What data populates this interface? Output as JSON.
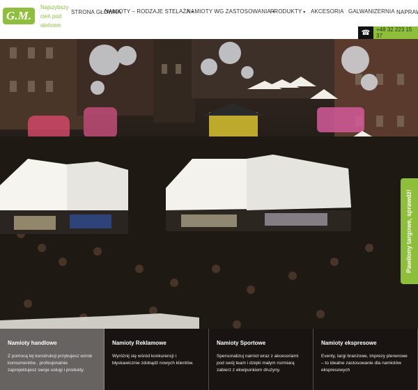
{
  "brand": {
    "logo_text": "G.M.",
    "tagline": "Najszybszy cień pod słońcem",
    "accent_color": "#8dbf3a"
  },
  "nav": {
    "items": [
      {
        "label": "STRONA GŁÓWNA"
      },
      {
        "label": "NAMIOTY – RODZAJE STELAŻA",
        "arrow": "▾"
      },
      {
        "label": "NAMIOTY WG ZASTOSOWANIA",
        "arrow": "▾"
      },
      {
        "label": "PRODUKTY",
        "arrow": "▾"
      },
      {
        "label": "AKCESORIA"
      },
      {
        "label": "GALWANIZERNIA"
      },
      {
        "label": "NAPRAWA NAMIOTÓW"
      }
    ]
  },
  "contact": {
    "phone": "+48 32 223 15 37",
    "icon": "phone-icon"
  },
  "side_badge": {
    "label": "Pawilony targowe, sprawdź!"
  },
  "cards": [
    {
      "title": "Namioty handlowe",
      "text": "Z pomocą tej konstrukcji przykujesz wzrok konsumentów , profesjonalnie zaprojektujesz swoje usługi i produkty."
    },
    {
      "title": "Namioty Reklamowe",
      "text": "Wyróżnij się wśród konkurencji i błyskawicznie zdobądź nowych klientów."
    },
    {
      "title": "Namioty Sportowe",
      "text": "Spersonalizuj namiot wraz z akcesoriami pod swój team i dzięki małym rozmiarą zabierz z ekwipunkiem drużyny."
    },
    {
      "title": "Namioty ekspresowe",
      "text": "Eventy, targi branżowe, imprezy plenerowe – to idealne zastosowanie dla namiotów ekspresowych"
    }
  ]
}
